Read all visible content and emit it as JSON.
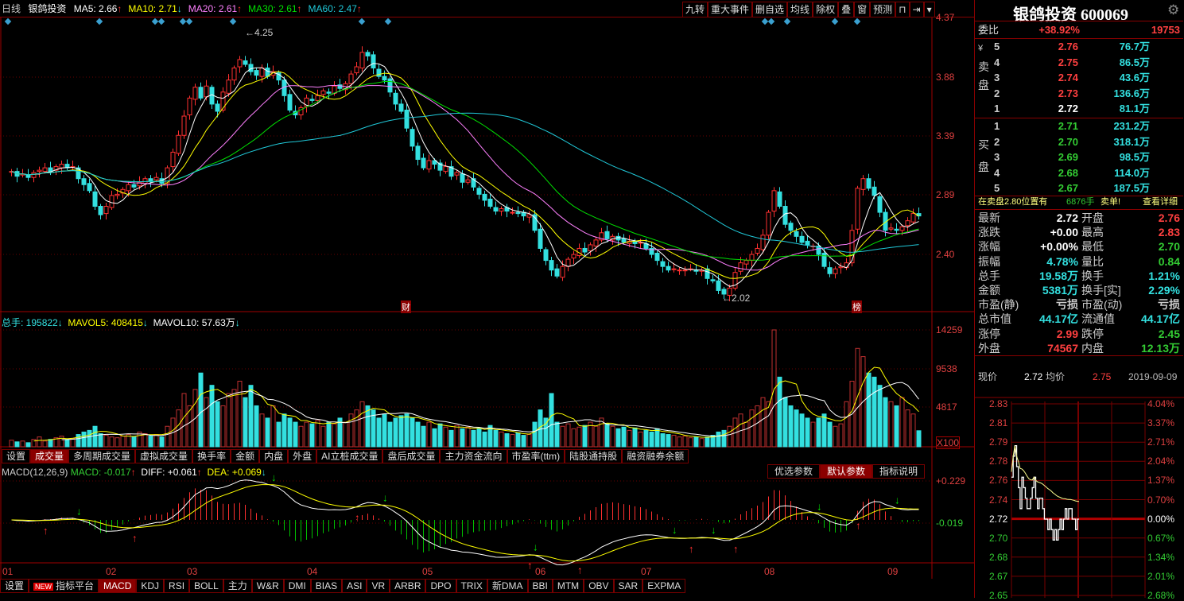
{
  "header": {
    "period": "日线",
    "name": "银鸽投资",
    "ma": [
      {
        "label": "MA5: 2.66",
        "color": "#ffffff",
        "dir": "up"
      },
      {
        "label": "MA10: 2.71",
        "color": "#ffff00",
        "dir": "down"
      },
      {
        "label": "MA20: 2.61",
        "color": "#ff80ff",
        "dir": "up"
      },
      {
        "label": "MA30: 2.61",
        "color": "#00e000",
        "dir": "up"
      },
      {
        "label": "MA60: 2.47",
        "color": "#20c8d8",
        "dir": "up"
      }
    ]
  },
  "toolbar": [
    "九转",
    "重大事件",
    "删自选",
    "均线",
    "除权",
    "叠",
    "窗",
    "预测"
  ],
  "toolbar_icons": [
    "lock-icon",
    "exit-icon",
    "dropdown-icon"
  ],
  "price_axis": [
    "4.37",
    "3.88",
    "3.39",
    "2.89",
    "2.40"
  ],
  "annotations": {
    "high": "4.25",
    "low": "2.02",
    "marker1": "财",
    "marker2": "榜"
  },
  "volume_header": {
    "total": "总手: 195822",
    "mavol5": "MAVOL5: 408415",
    "mavol10": "MAVOL10: 57.63万"
  },
  "volume_axis": [
    "14259",
    "9538",
    "4817",
    "X100"
  ],
  "volume_tabs": [
    "设置",
    "成交量",
    "多周期成交量",
    "虚拟成交量",
    "换手率",
    "金额",
    "内盘",
    "外盘",
    "AI立桩成交量",
    "盘后成交量",
    "主力资金流向",
    "市盈率(ttm)",
    "陆股通持股",
    "融资融券余额"
  ],
  "volume_tab_active": 1,
  "macd_header": {
    "name": "MACD(12,26,9)",
    "macd": "MACD: -0.017",
    "diff": "DIFF: +0.061",
    "dea": "DEA: +0.069"
  },
  "macd_buttons": [
    "优选参数",
    "默认参数",
    "指标说明"
  ],
  "macd_axis": [
    "+0.229",
    "-0.019"
  ],
  "months": [
    "01",
    "02",
    "03",
    "04",
    "05",
    "06",
    "07",
    "08",
    "09"
  ],
  "indicator_tabs": [
    "设置",
    "指标平台",
    "MACD",
    "KDJ",
    "RSI",
    "BOLL",
    "主力",
    "W&R",
    "DMI",
    "BIAS",
    "ASI",
    "VR",
    "ARBR",
    "DPO",
    "TRIX",
    "新DMA",
    "BBI",
    "MTM",
    "OBV",
    "SAR",
    "EXPMA"
  ],
  "indicator_new_badge": "NEW",
  "indicator_active": 2,
  "colors": {
    "up": "#ff3030",
    "down": "#33e0e0",
    "grid": "#800000"
  },
  "chart_data": {
    "type": "candlestick",
    "close": [
      3.09,
      3.05,
      3.07,
      3.04,
      3.08,
      3.1,
      3.12,
      3.09,
      3.13,
      3.15,
      3.12,
      3.13,
      3.03,
      2.98,
      2.93,
      2.8,
      2.73,
      2.8,
      2.89,
      2.9,
      2.94,
      2.98,
      2.96,
      3.0,
      3.03,
      3.01,
      3.04,
      2.99,
      3.12,
      3.25,
      3.39,
      3.55,
      3.7,
      3.79,
      3.7,
      3.8,
      3.65,
      3.59,
      3.75,
      3.85,
      3.95,
      4.02,
      3.98,
      3.92,
      3.89,
      3.95,
      3.88,
      3.92,
      3.85,
      3.72,
      3.6,
      3.56,
      3.62,
      3.7,
      3.68,
      3.72,
      3.76,
      3.74,
      3.8,
      3.78,
      3.82,
      3.9,
      3.96,
      4.08,
      4.05,
      3.95,
      3.88,
      3.85,
      3.75,
      3.65,
      3.59,
      3.45,
      3.3,
      3.19,
      3.12,
      3.18,
      3.15,
      3.1,
      3.13,
      3.05,
      3.08,
      3.0,
      3.02,
      2.96,
      2.9,
      2.85,
      2.8,
      2.76,
      2.78,
      2.76,
      2.75,
      2.74,
      2.72,
      2.73,
      2.6,
      2.45,
      2.35,
      2.27,
      2.22,
      2.3,
      2.36,
      2.4,
      2.45,
      2.42,
      2.48,
      2.52,
      2.58,
      2.53,
      2.55,
      2.52,
      2.5,
      2.51,
      2.49,
      2.5,
      2.45,
      2.4,
      2.35,
      2.3,
      2.27,
      2.28,
      2.27,
      2.27,
      2.28,
      2.26,
      2.27,
      2.2,
      2.18,
      2.1,
      2.07,
      2.12,
      2.25,
      2.33,
      2.35,
      2.4,
      2.45,
      2.56,
      2.75,
      2.93,
      2.8,
      2.65,
      2.6,
      2.55,
      2.5,
      2.48,
      2.47,
      2.4,
      2.3,
      2.24,
      2.28,
      2.3,
      2.33,
      2.6,
      2.95,
      3.03,
      2.95,
      2.89,
      2.75,
      2.6,
      2.62,
      2.6,
      2.63,
      2.68,
      2.74,
      2.72
    ],
    "volume": [
      800,
      600,
      700,
      500,
      900,
      1200,
      700,
      900,
      1100,
      1300,
      900,
      1000,
      1500,
      1800,
      2000,
      2500,
      1600,
      1400,
      1200,
      1100,
      1300,
      1500,
      1200,
      1800,
      1600,
      1300,
      1500,
      1200,
      2500,
      3500,
      4500,
      6500,
      5000,
      7000,
      9000,
      6000,
      7500,
      5500,
      5000,
      6500,
      7000,
      8000,
      6000,
      7500,
      5000,
      4000,
      3500,
      5000,
      3000,
      4000,
      3500,
      3000,
      2500,
      3000,
      2800,
      3200,
      2500,
      3000,
      2800,
      3500,
      3000,
      4000,
      4500,
      5500,
      5000,
      4500,
      3500,
      4000,
      3000,
      3500,
      3800,
      4000,
      3500,
      3000,
      2500,
      3000,
      2200,
      2800,
      2400,
      2000,
      2600,
      2200,
      2400,
      2000,
      2200,
      1800,
      2600,
      2000,
      1800,
      1600,
      1500,
      1700,
      1400,
      1500,
      3000,
      4500,
      3500,
      6500,
      3000,
      2500,
      2800,
      2200,
      2400,
      2600,
      3000,
      2500,
      3500,
      2800,
      2500,
      2200,
      2400,
      2000,
      2300,
      1800,
      2000,
      1800,
      2200,
      1600,
      1500,
      1400,
      1200,
      1300,
      1100,
      1200,
      1000,
      1200,
      1400,
      1800,
      2000,
      2500,
      3500,
      4000,
      3000,
      4500,
      5000,
      6000,
      5500,
      14259,
      8500,
      6000,
      5000,
      4500,
      4000,
      3500,
      3000,
      3500,
      4000,
      3000,
      2500,
      2800,
      5500,
      8000,
      12000,
      11000,
      9000,
      8500,
      7500,
      6000,
      5500,
      5000,
      6000,
      4500,
      4000,
      1958
    ],
    "price_range": [
      1.94,
      4.37
    ],
    "volume_range": [
      0,
      14259
    ],
    "macd_params": [
      12,
      26,
      9
    ]
  },
  "quote": {
    "title": "银鸽投资 600069",
    "weibi_label": "委比",
    "weibi": "+38.92%",
    "weicha": "19753",
    "sell_label": [
      "¥",
      "卖",
      "盘"
    ],
    "buy_label": [
      "买",
      "盘"
    ],
    "sell": [
      {
        "lvl": "5",
        "price": "2.76",
        "vol": "76.7万"
      },
      {
        "lvl": "4",
        "price": "2.75",
        "vol": "86.5万"
      },
      {
        "lvl": "3",
        "price": "2.74",
        "vol": "43.6万"
      },
      {
        "lvl": "2",
        "price": "2.73",
        "vol": "136.6万"
      },
      {
        "lvl": "1",
        "price": "2.72",
        "vol": "81.1万"
      }
    ],
    "buy": [
      {
        "lvl": "1",
        "price": "2.71",
        "vol": "231.2万"
      },
      {
        "lvl": "2",
        "price": "2.70",
        "vol": "318.1万"
      },
      {
        "lvl": "3",
        "price": "2.69",
        "vol": "98.5万"
      },
      {
        "lvl": "4",
        "price": "2.68",
        "vol": "114.0万"
      },
      {
        "lvl": "5",
        "price": "2.67",
        "vol": "187.5万"
      }
    ],
    "notice": {
      "text": "在卖盘2.80位置有",
      "qty": "6876手",
      "tail": "卖单!",
      "link": "查看详细"
    },
    "stats": [
      [
        "最新",
        "2.72",
        "#ffffff",
        "开盘",
        "2.76",
        "#ff4040"
      ],
      [
        "涨跌",
        "+0.00",
        "#ffffff",
        "最高",
        "2.83",
        "#ff4040"
      ],
      [
        "涨幅",
        "+0.00%",
        "#ffffff",
        "最低",
        "2.70",
        "#33cc33"
      ],
      [
        "振幅",
        "4.78%",
        "#33e0e0",
        "量比",
        "0.84",
        "#33cc33"
      ],
      [
        "总手",
        "19.58万",
        "#33e0e0",
        "换手",
        "1.21%",
        "#33e0e0"
      ],
      [
        "金额",
        "5381万",
        "#33e0e0",
        "换手[实]",
        "2.29%",
        "#33e0e0"
      ],
      [
        "市盈(静)",
        "亏损",
        "#cccccc",
        "市盈(动)",
        "亏损",
        "#cccccc"
      ],
      [
        "总市值",
        "44.17亿",
        "#33e0e0",
        "流通值",
        "44.17亿",
        "#33e0e0"
      ],
      [
        "涨停",
        "2.99",
        "#ff4040",
        "跌停",
        "2.45",
        "#33cc33"
      ],
      [
        "外盘",
        "74567",
        "#ff4040",
        "内盘",
        "12.13万",
        "#33cc33"
      ]
    ]
  },
  "intraday": {
    "price_label": "现价",
    "price": "2.72",
    "avg_label": "均价",
    "avg": "2.75",
    "date": "2019-09-09",
    "left_axis": [
      "2.83",
      "2.81",
      "2.79",
      "2.78",
      "2.76",
      "2.74",
      "2.72",
      "2.70",
      "2.68",
      "2.67",
      "2.65"
    ],
    "right_axis": [
      "4.04%",
      "3.37%",
      "2.71%",
      "2.04%",
      "1.37%",
      "0.70%",
      "0.00%",
      "0.67%",
      "1.34%",
      "2.01%",
      "2.68%"
    ],
    "prev_close": 2.72,
    "prices": [
      2.76,
      2.78,
      2.79,
      2.77,
      2.75,
      2.73,
      2.76,
      2.75,
      2.74,
      2.73,
      2.73,
      2.74,
      2.75,
      2.76,
      2.74,
      2.73,
      2.74,
      2.74,
      2.73,
      2.72,
      2.72,
      2.71,
      2.72,
      2.71,
      2.7,
      2.71,
      2.7,
      2.71,
      2.72,
      2.71,
      2.72,
      2.73,
      2.72,
      2.73,
      2.73,
      2.72,
      2.72,
      2.71,
      2.72,
      2.72
    ]
  }
}
